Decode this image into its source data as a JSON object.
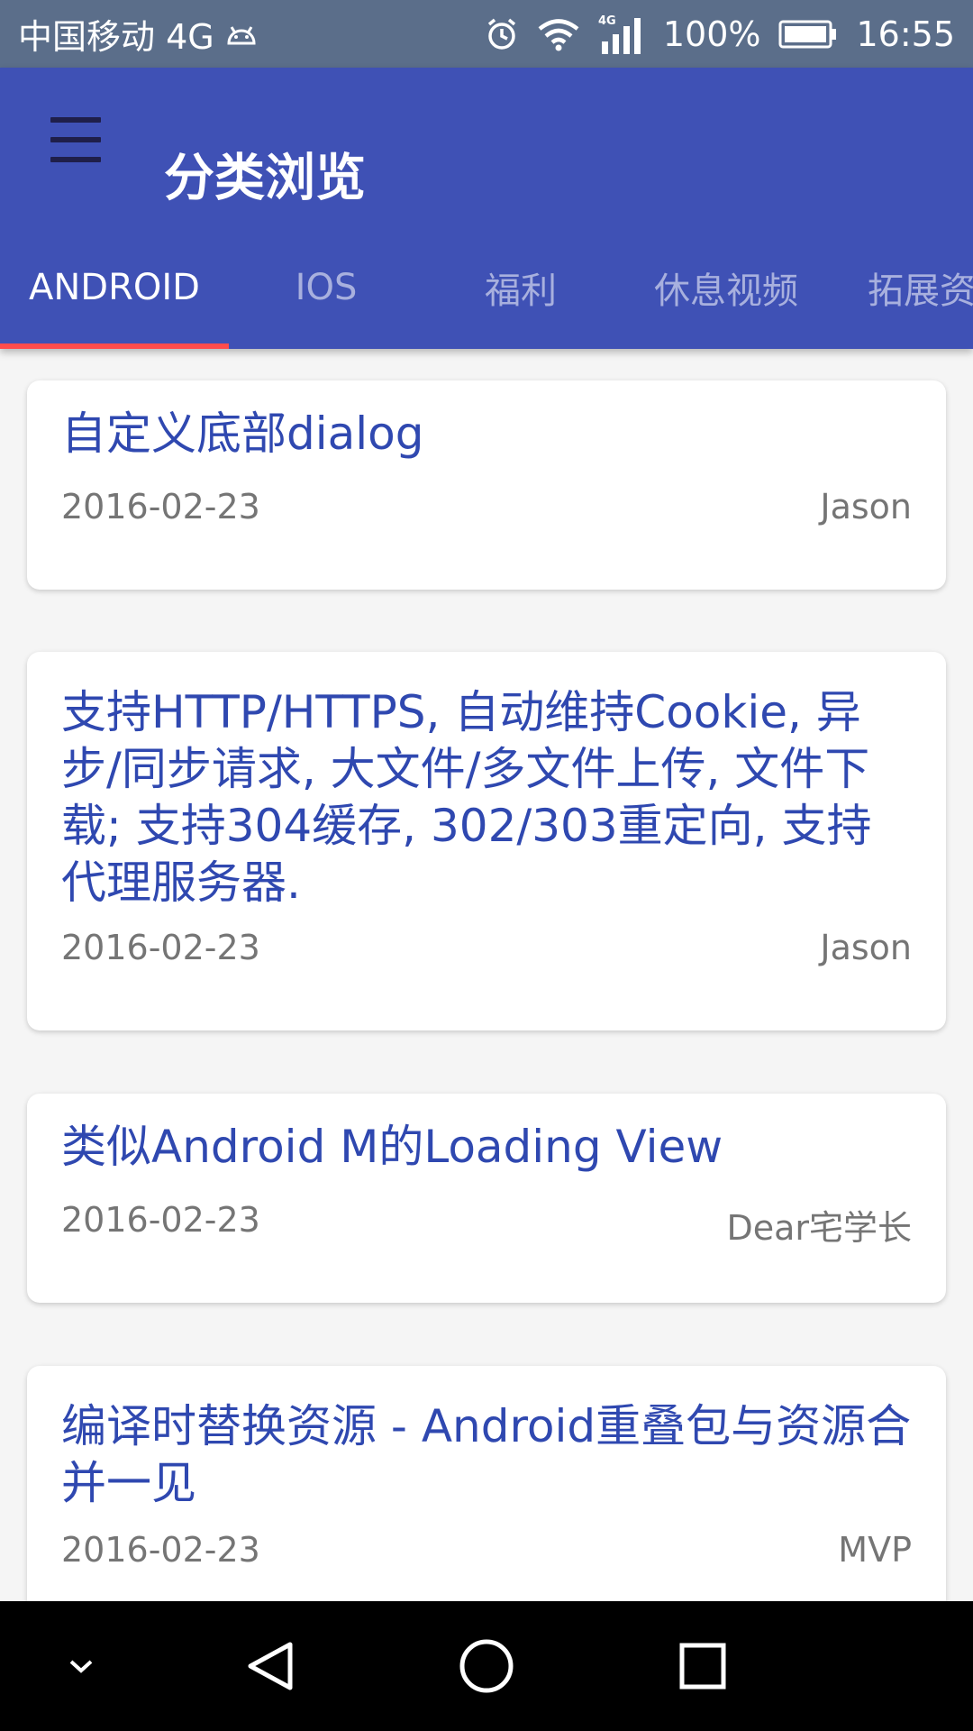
{
  "status_bar": {
    "carrier": "中国移动 4G",
    "battery": "100%",
    "time": "16:55",
    "network_badge": "4G",
    "icons": [
      "android-icon",
      "alarm-icon",
      "wifi-icon",
      "signal-icon",
      "battery-icon"
    ]
  },
  "app_bar": {
    "title": "分类浏览",
    "menu_icon": "hamburger-menu-icon",
    "background_color": "#3f51b5",
    "indicator_color": "#ff4c4c"
  },
  "tabs": [
    {
      "label": "ANDROID",
      "active": true
    },
    {
      "label": "IOS",
      "active": false
    },
    {
      "label": "福利",
      "active": false
    },
    {
      "label": "休息视频",
      "active": false
    },
    {
      "label": "拓展资源",
      "active": false
    }
  ],
  "cards": [
    {
      "title": "自定义底部dialog",
      "date": "2016-02-23",
      "author": "Jason"
    },
    {
      "title": "支持HTTP/HTTPS, 自动维持Cookie, 异步/同步请求, 大文件/多文件上传, 文件下载; 支持304缓存, 302/303重定向, 支持代理服务器.",
      "date": "2016-02-23",
      "author": "Jason"
    },
    {
      "title": "类似Android M的Loading View",
      "date": "2016-02-23",
      "author": "Dear宅学长"
    },
    {
      "title": "编译时替换资源 - Android重叠包与资源合并一见",
      "date": "2016-02-23",
      "author": "MVP"
    }
  ],
  "nav_bar": {
    "icons": [
      "collapse-chevron-icon",
      "back-triangle-icon",
      "home-circle-icon",
      "recents-square-icon"
    ]
  }
}
